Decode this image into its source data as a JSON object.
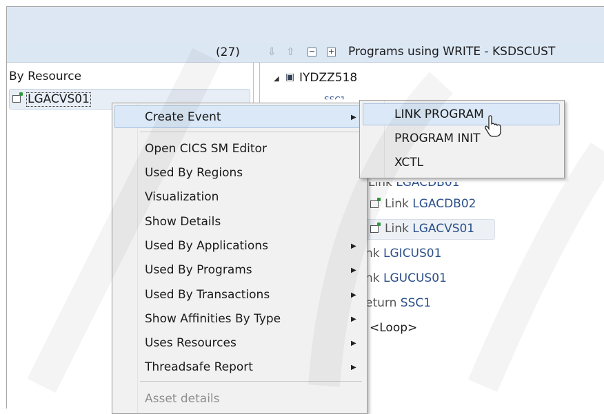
{
  "header": {
    "count": "(27)",
    "title": "Programs using WRITE - KSDSCUST"
  },
  "left_panel": {
    "heading": "By Resource",
    "item": "LGACVS01"
  },
  "tree": {
    "root": "IYDZZ518",
    "partial": "SSC1",
    "rows": [
      {
        "prefix": "Link ",
        "name": "LGACDB01"
      },
      {
        "prefix": "Link ",
        "name": "LGACDB02"
      },
      {
        "prefix": "Link ",
        "name": "LGACVS01"
      },
      {
        "prefix": "nk ",
        "name": "LGICUS01"
      },
      {
        "prefix": "nk ",
        "name": "LGUCUS01"
      },
      {
        "prefix": "eturn ",
        "name": "SSC1"
      },
      {
        "prefix": "",
        "name": "<Loop>"
      }
    ]
  },
  "context_menu": {
    "items": [
      {
        "label": "Create Event",
        "submenu": true
      },
      {
        "label": "Open CICS SM Editor",
        "submenu": false
      },
      {
        "label": "Used By Regions",
        "submenu": false
      },
      {
        "label": "Visualization",
        "submenu": false
      },
      {
        "label": "Show Details",
        "submenu": false
      },
      {
        "label": "Used By Applications",
        "submenu": true
      },
      {
        "label": "Used By Programs",
        "submenu": true
      },
      {
        "label": "Used By Transactions",
        "submenu": true
      },
      {
        "label": "Show Affinities By Type",
        "submenu": true
      },
      {
        "label": "Uses Resources",
        "submenu": true
      },
      {
        "label": "Threadsafe Report",
        "submenu": true
      },
      {
        "label": "Asset details",
        "submenu": false,
        "disabled": true
      }
    ]
  },
  "submenu": {
    "items": [
      "LINK PROGRAM",
      "PROGRAM INIT",
      "XCTL"
    ]
  }
}
